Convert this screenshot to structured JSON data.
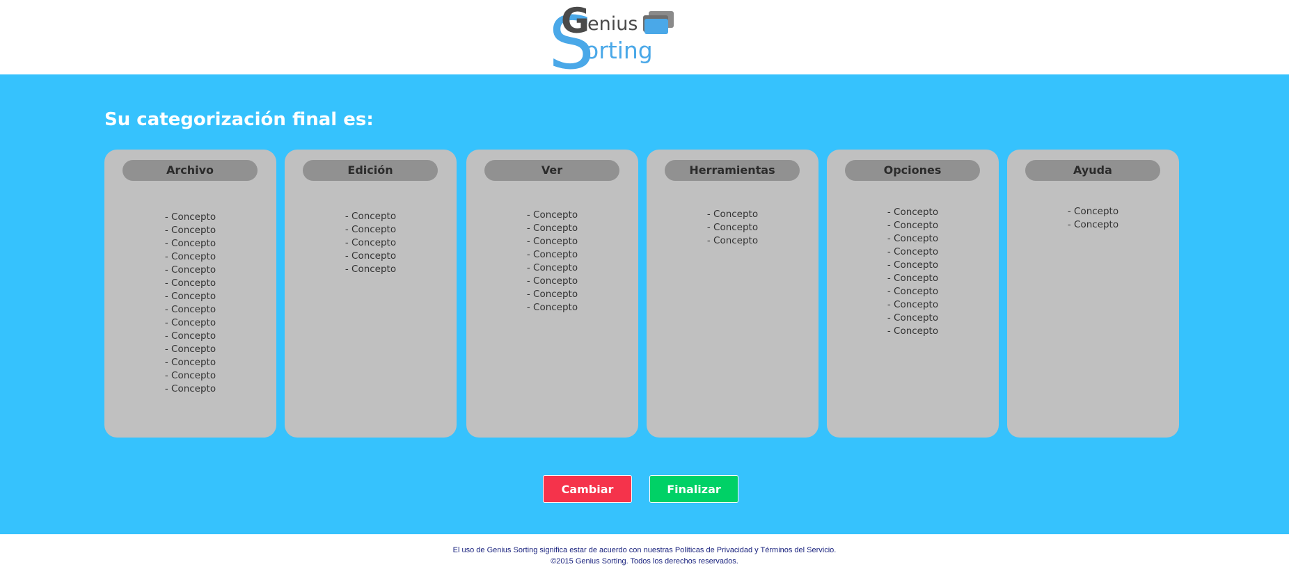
{
  "header": {
    "logo": {
      "word1": "Genius",
      "word2": "Sorting",
      "colors": {
        "gray": "#4a4a4a",
        "blue": "#4aa8e8"
      }
    }
  },
  "main": {
    "title": "Su categorización final es:",
    "columns": [
      {
        "title": "Archivo",
        "items": [
          "- Concepto",
          "- Concepto",
          "- Concepto",
          "- Concepto",
          "- Concepto",
          "- Concepto",
          "- Concepto",
          "- Concepto",
          "- Concepto",
          "- Concepto",
          "- Concepto",
          "- Concepto",
          "- Concepto",
          "- Concepto"
        ]
      },
      {
        "title": "Edición",
        "items": [
          "- Concepto",
          "- Concepto",
          "- Concepto",
          "- Concepto",
          "- Concepto"
        ]
      },
      {
        "title": "Ver",
        "items": [
          "- Concepto",
          "- Concepto",
          "- Concepto",
          "- Concepto",
          "- Concepto",
          "- Concepto",
          "- Concepto",
          "- Concepto"
        ]
      },
      {
        "title": "Herramientas",
        "items": [
          "- Concepto",
          "- Concepto",
          "- Concepto"
        ]
      },
      {
        "title": "Opciones",
        "items": [
          "- Concepto",
          "- Concepto",
          "- Concepto",
          "- Concepto",
          "- Concepto",
          "- Concepto",
          "- Concepto",
          "- Concepto",
          "- Concepto",
          "- Concepto"
        ]
      },
      {
        "title": "Ayuda",
        "items": [
          "- Concepto",
          "- Concepto"
        ]
      }
    ],
    "buttons": {
      "change_label": "Cambiar",
      "finish_label": "Finalizar"
    }
  },
  "footer": {
    "line1": "El uso de Genius Sorting significa estar de acuerdo con nuestras Políticas de Privacidad y Términos del Servicio.",
    "line2": "©2015 Genius Sorting. Todos los derechos reservados."
  },
  "colors": {
    "background_main": "#36c2fd",
    "card": "#c0c0c0",
    "card_header": "#919191",
    "button_change": "#f5334b",
    "button_finish": "#00d166",
    "footer_text": "#1a237e"
  }
}
